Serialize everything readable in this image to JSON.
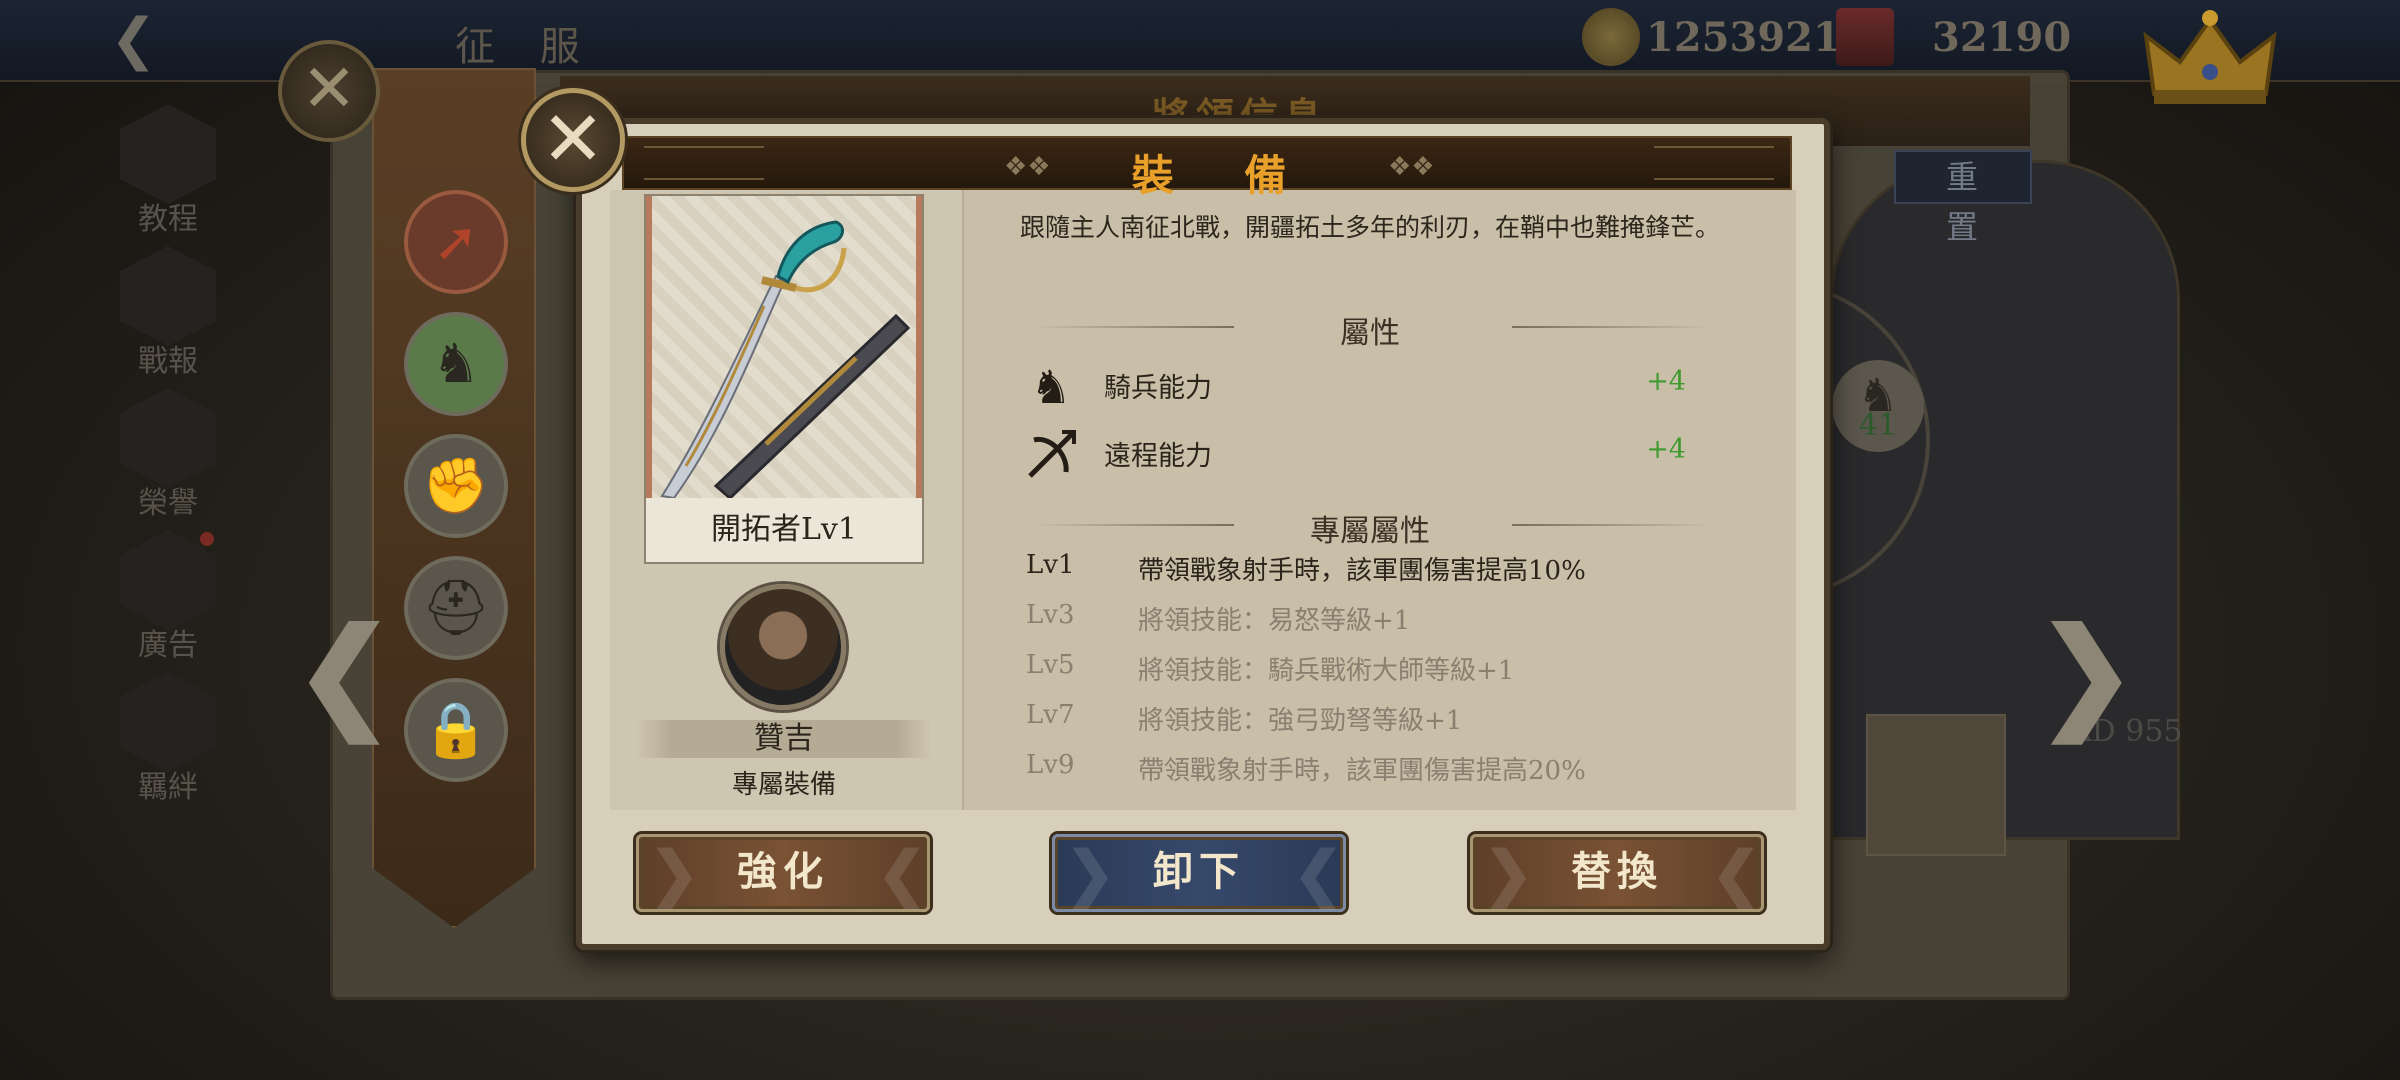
{
  "background": {
    "top_title": "征 服",
    "resources": [
      {
        "icon": "gold-coin-icon",
        "value": "1253921"
      },
      {
        "icon": "crown-currency-icon",
        "value": "32190"
      }
    ],
    "left_menu": [
      {
        "label": "教程",
        "icon": "book-icon"
      },
      {
        "label": "戰報",
        "icon": "scroll-icon"
      },
      {
        "label": "榮譽",
        "icon": "sword-icon"
      },
      {
        "label": "廣告",
        "icon": "film-icon"
      },
      {
        "label": "羈絆",
        "icon": "handshake-icon"
      }
    ],
    "panel_title": "將領信息",
    "reset_label": "重 置",
    "medal_value": "41",
    "ad_text": "AD 955"
  },
  "modal": {
    "title": "裝 備",
    "item": {
      "name": "開拓者Lv1",
      "description": "跟隨主人南征北戰，開疆拓土多年的利刃，在鞘中也難掩鋒芒。"
    },
    "hero": {
      "name": "贊吉",
      "subtitle": "專屬裝備"
    },
    "attributes_title": "屬性",
    "attributes": [
      {
        "icon": "knight-horse-icon",
        "label": "騎兵能力",
        "value": "+4"
      },
      {
        "icon": "crossbow-icon",
        "label": "遠程能力",
        "value": "+4"
      }
    ],
    "exclusive_title": "專屬屬性",
    "exclusive": [
      {
        "level": "Lv1",
        "text": "帶領戰象射手時，該軍團傷害提高10%",
        "active": true
      },
      {
        "level": "Lv3",
        "text": "將領技能：易怒等級+1",
        "active": false
      },
      {
        "level": "Lv5",
        "text": "將領技能：騎兵戰術大師等級+1",
        "active": false
      },
      {
        "level": "Lv7",
        "text": "將領技能：強弓勁弩等級+1",
        "active": false
      },
      {
        "level": "Lv9",
        "text": "帶領戰象射手時，該軍團傷害提高20%",
        "active": false
      }
    ],
    "buttons": {
      "enhance": "強化",
      "unequip": "卸下",
      "replace": "替換"
    }
  },
  "colors": {
    "title_gold": "#e8a02a",
    "bonus_green": "#3f9a2e",
    "parchment": "#d8cfbb"
  }
}
